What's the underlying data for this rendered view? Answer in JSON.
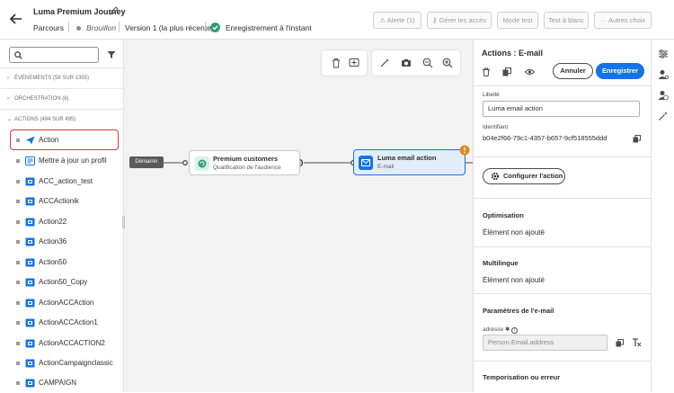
{
  "header": {
    "journey_title": "Luma Premium Journey",
    "breadcrumb": "Parcours",
    "status": "Brouillon",
    "version": "Version 1 (la plus récente)",
    "save_state": "Enregistrement à l'instant",
    "alert_button": "Alerte (1)",
    "access_button": "Gérer les accès",
    "test_mode_button": "Mode test",
    "dry_run_button": "Test à blanc",
    "more_button": "Autres choix"
  },
  "left_panel": {
    "search_placeholder": "",
    "sections": {
      "events": "ÉVÉNEMENTS (58 SUR 1355)",
      "orchestration": "ORCHESTRATION (6)",
      "actions": "ACTIONS (494 SUR 495)"
    },
    "items": [
      {
        "label": "Action"
      },
      {
        "label": "Mettre à jour un profil"
      },
      {
        "label": "ACC_action_test"
      },
      {
        "label": "ACCActionik"
      },
      {
        "label": "Action22"
      },
      {
        "label": "Action36"
      },
      {
        "label": "Action50"
      },
      {
        "label": "Action50_Copy"
      },
      {
        "label": "ActionACCAction"
      },
      {
        "label": "ActionACCAction1"
      },
      {
        "label": "ActionACCACTION2"
      },
      {
        "label": "ActionCampaignclassic"
      },
      {
        "label": "CAMPAIGN"
      }
    ]
  },
  "canvas": {
    "start_label": "Démarrer",
    "node1": {
      "title": "Premium customers",
      "subtitle": "Qualification de l'audience"
    },
    "node2": {
      "title": "Luma email action",
      "subtitle": "E-mail"
    }
  },
  "right_panel": {
    "title": "Actions : E-mail",
    "cancel_button": "Annuler",
    "save_button": "Enregistrer",
    "label_field_label": "Libellé",
    "label_field_value": "Luma email action",
    "identifier_label": "Identifiant",
    "identifier_value": "b04e2f66-79c1-4357-b657-9cf518555ddd",
    "configure_button": "Configurer l'action",
    "optimisation_title": "Optimisation",
    "optimisation_value": "Élément non ajouté",
    "multilingual_title": "Multilingue",
    "multilingual_value": "Élément non ajouté",
    "email_params_title": "Paramètres de l'e-mail",
    "address_label": "adresse",
    "address_placeholder": "Person.Email.address",
    "timeout_title": "Temporisation ou erreur"
  },
  "colors": {
    "accent": "#1473e6",
    "selection": "#d7373f",
    "success": "#2d9d78",
    "warning": "#e68619"
  }
}
